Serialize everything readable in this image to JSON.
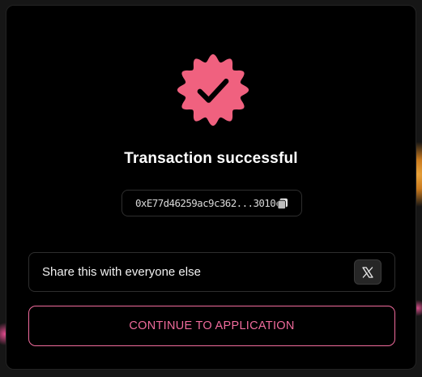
{
  "modal": {
    "title": "Transaction successful",
    "transaction_hash": "0xE77d46259ac9c362...3010c",
    "share_text": "Share this with everyone else",
    "continue_label": "CONTINUE TO APPLICATION"
  },
  "icons": {
    "badge": "verified-badge-icon",
    "copy": "copy-icon",
    "share": "x-logo-icon"
  },
  "colors": {
    "accent": "#f06b9c",
    "badge": "#f0617f",
    "background": "#000000"
  }
}
